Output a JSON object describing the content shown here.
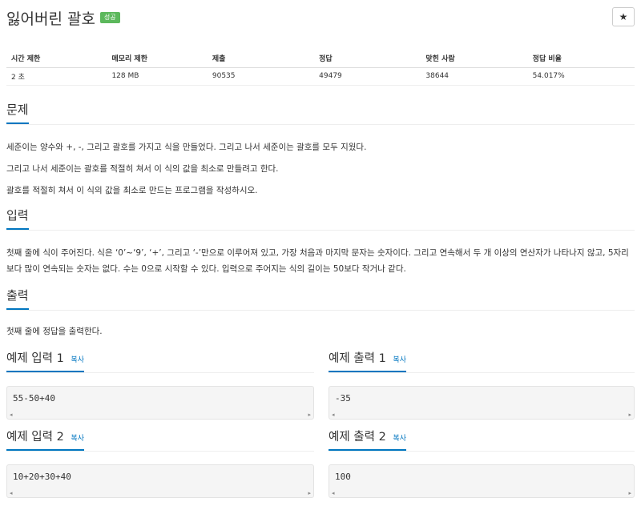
{
  "header": {
    "title": "잃어버린 괄호",
    "badge": "성공",
    "star_icon": "★"
  },
  "info_table": {
    "headers": [
      "시간 제한",
      "메모리 제한",
      "제출",
      "정답",
      "맞힌 사람",
      "정답 비율"
    ],
    "row": [
      "2 초",
      "128 MB",
      "90535",
      "49479",
      "38644",
      "54.017%"
    ]
  },
  "problem": {
    "heading": "문제",
    "lines": [
      "세준이는 양수와 +, -, 그리고 괄호를 가지고 식을 만들었다. 그리고 나서 세준이는 괄호를 모두 지웠다.",
      "그리고 나서 세준이는 괄호를 적절히 쳐서 이 식의 값을 최소로 만들려고 한다.",
      "괄호를 적절히 쳐서 이 식의 값을 최소로 만드는 프로그램을 작성하시오."
    ]
  },
  "input": {
    "heading": "입력",
    "text": "첫째 줄에 식이 주어진다. 식은 ‘0’~‘9’, ‘+’, 그리고 ‘-’만으로 이루어져 있고, 가장 처음과 마지막 문자는 숫자이다. 그리고 연속해서 두 개 이상의 연산자가 나타나지 않고, 5자리보다 많이 연속되는 숫자는 없다. 수는 0으로 시작할 수 있다. 입력으로 주어지는 식의 길이는 50보다 작거나 같다."
  },
  "output": {
    "heading": "출력",
    "text": "첫째 줄에 정답을 출력한다."
  },
  "samples": {
    "copy_label": "복사",
    "in1_title": "예제 입력 1",
    "out1_title": "예제 출력 1",
    "in2_title": "예제 입력 2",
    "out2_title": "예제 출력 2",
    "in1": "55-50+40",
    "out1": "-35",
    "in2": "10+20+30+40",
    "out2": "100",
    "scroll_left": "◂",
    "scroll_right": "▸"
  }
}
